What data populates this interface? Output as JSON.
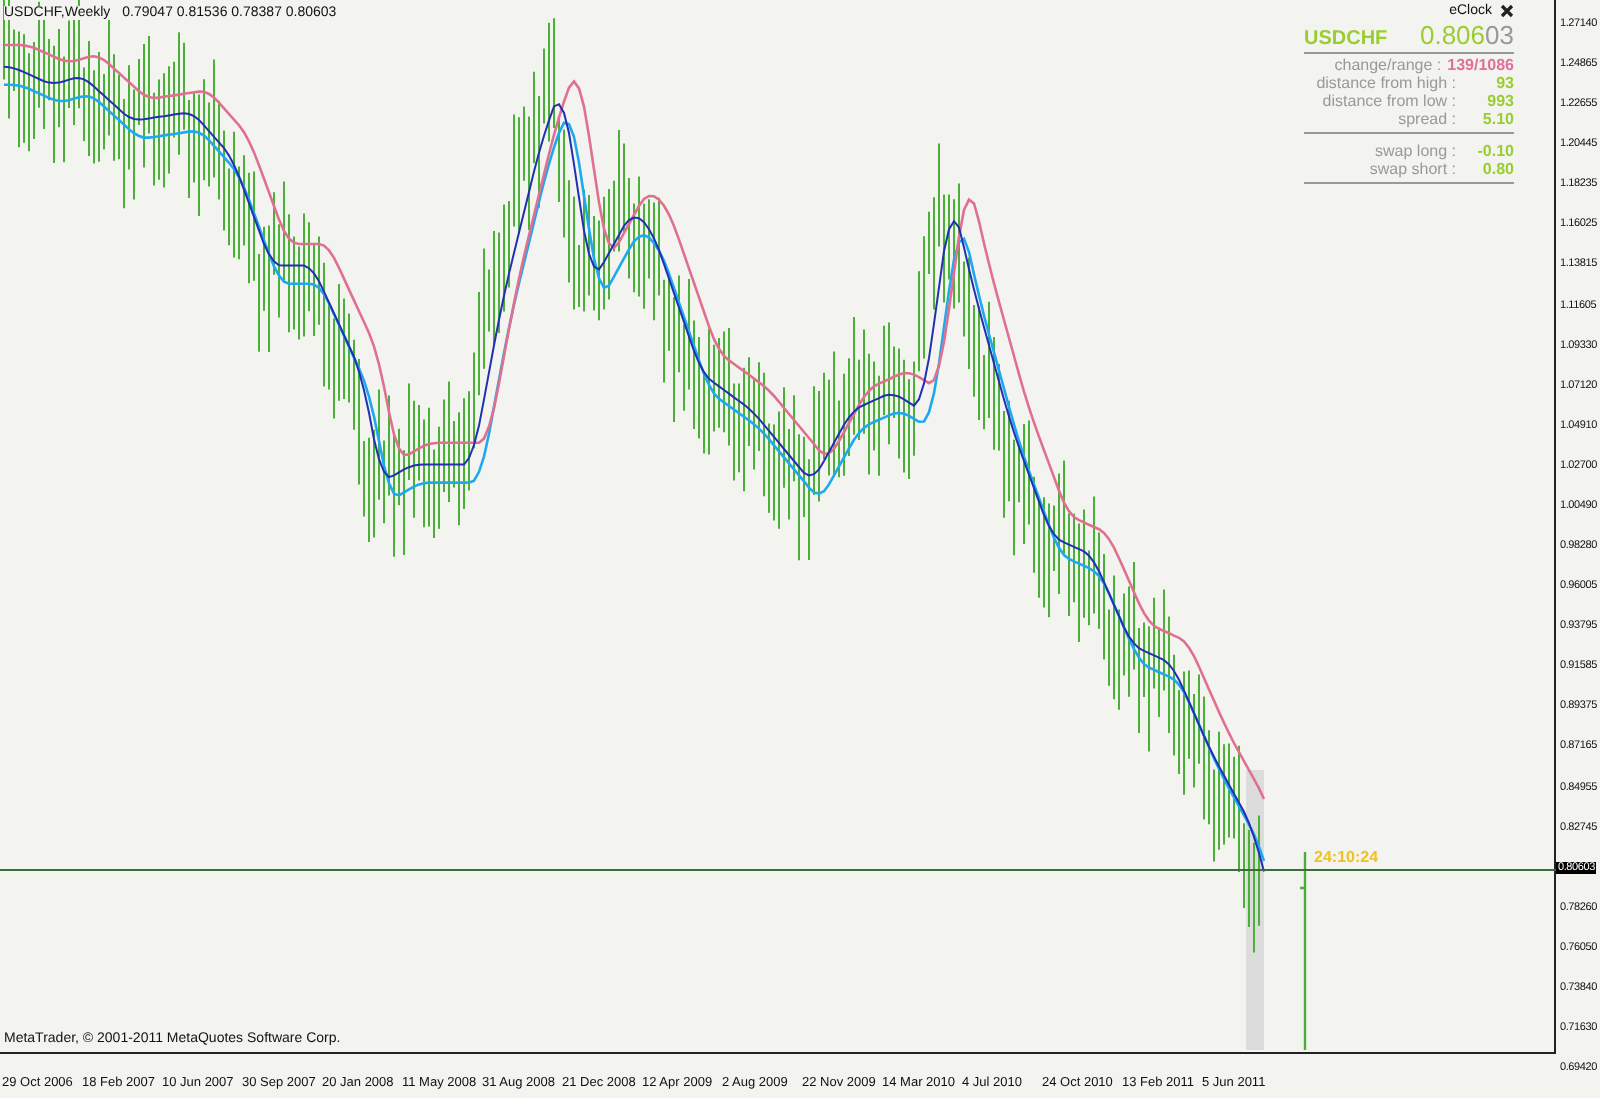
{
  "chart": {
    "symbol_period": "USDCHF,Weekly",
    "ohlc": "0.79047 0.81536 0.78387 0.80603",
    "copyright": "MetaTrader, © 2001-2011 MetaQuotes Software Corp.",
    "countdown": "24:10:24",
    "current_price": "0.80603",
    "price_axis": [
      "1.27140",
      "1.24865",
      "1.22655",
      "1.20445",
      "1.18235",
      "1.16025",
      "1.13815",
      "1.11605",
      "1.09330",
      "1.07120",
      "1.04910",
      "1.02700",
      "1.00490",
      "0.98280",
      "0.96005",
      "0.93795",
      "0.91585",
      "0.89375",
      "0.87165",
      "0.84955",
      "0.82745",
      "0.78260",
      "0.76050",
      "0.73840",
      "0.71630",
      "0.69420"
    ],
    "time_axis": [
      "29 Oct 2006",
      "18 Feb 2007",
      "10 Jun 2007",
      "30 Sep 2007",
      "20 Jan 2008",
      "11 May 2008",
      "31 Aug 2008",
      "21 Dec 2008",
      "12 Apr 2009",
      "2 Aug 2009",
      "22 Nov 2009",
      "14 Mar 2010",
      "4 Jul 2010",
      "24 Oct 2010",
      "13 Feb 2011",
      "5 Jun 2011"
    ]
  },
  "eclock": {
    "title": "eClock",
    "symbol": "USDCHF",
    "price": "0.806",
    "price_pips": "03",
    "groups": [
      [
        {
          "label": "change/range :",
          "value": "139/1086",
          "color": "#e0709a"
        },
        {
          "label": "distance from high :",
          "value": "93",
          "color": "#9acd32"
        },
        {
          "label": "distance from low :",
          "value": "993",
          "color": "#9acd32"
        },
        {
          "label": "spread :",
          "value": "5.10",
          "color": "#9acd32"
        }
      ],
      [
        {
          "label": "swap long :",
          "value": "-0.10",
          "color": "#9acd32"
        },
        {
          "label": "swap short :",
          "value": "0.80",
          "color": "#9acd32"
        }
      ]
    ]
  }
}
